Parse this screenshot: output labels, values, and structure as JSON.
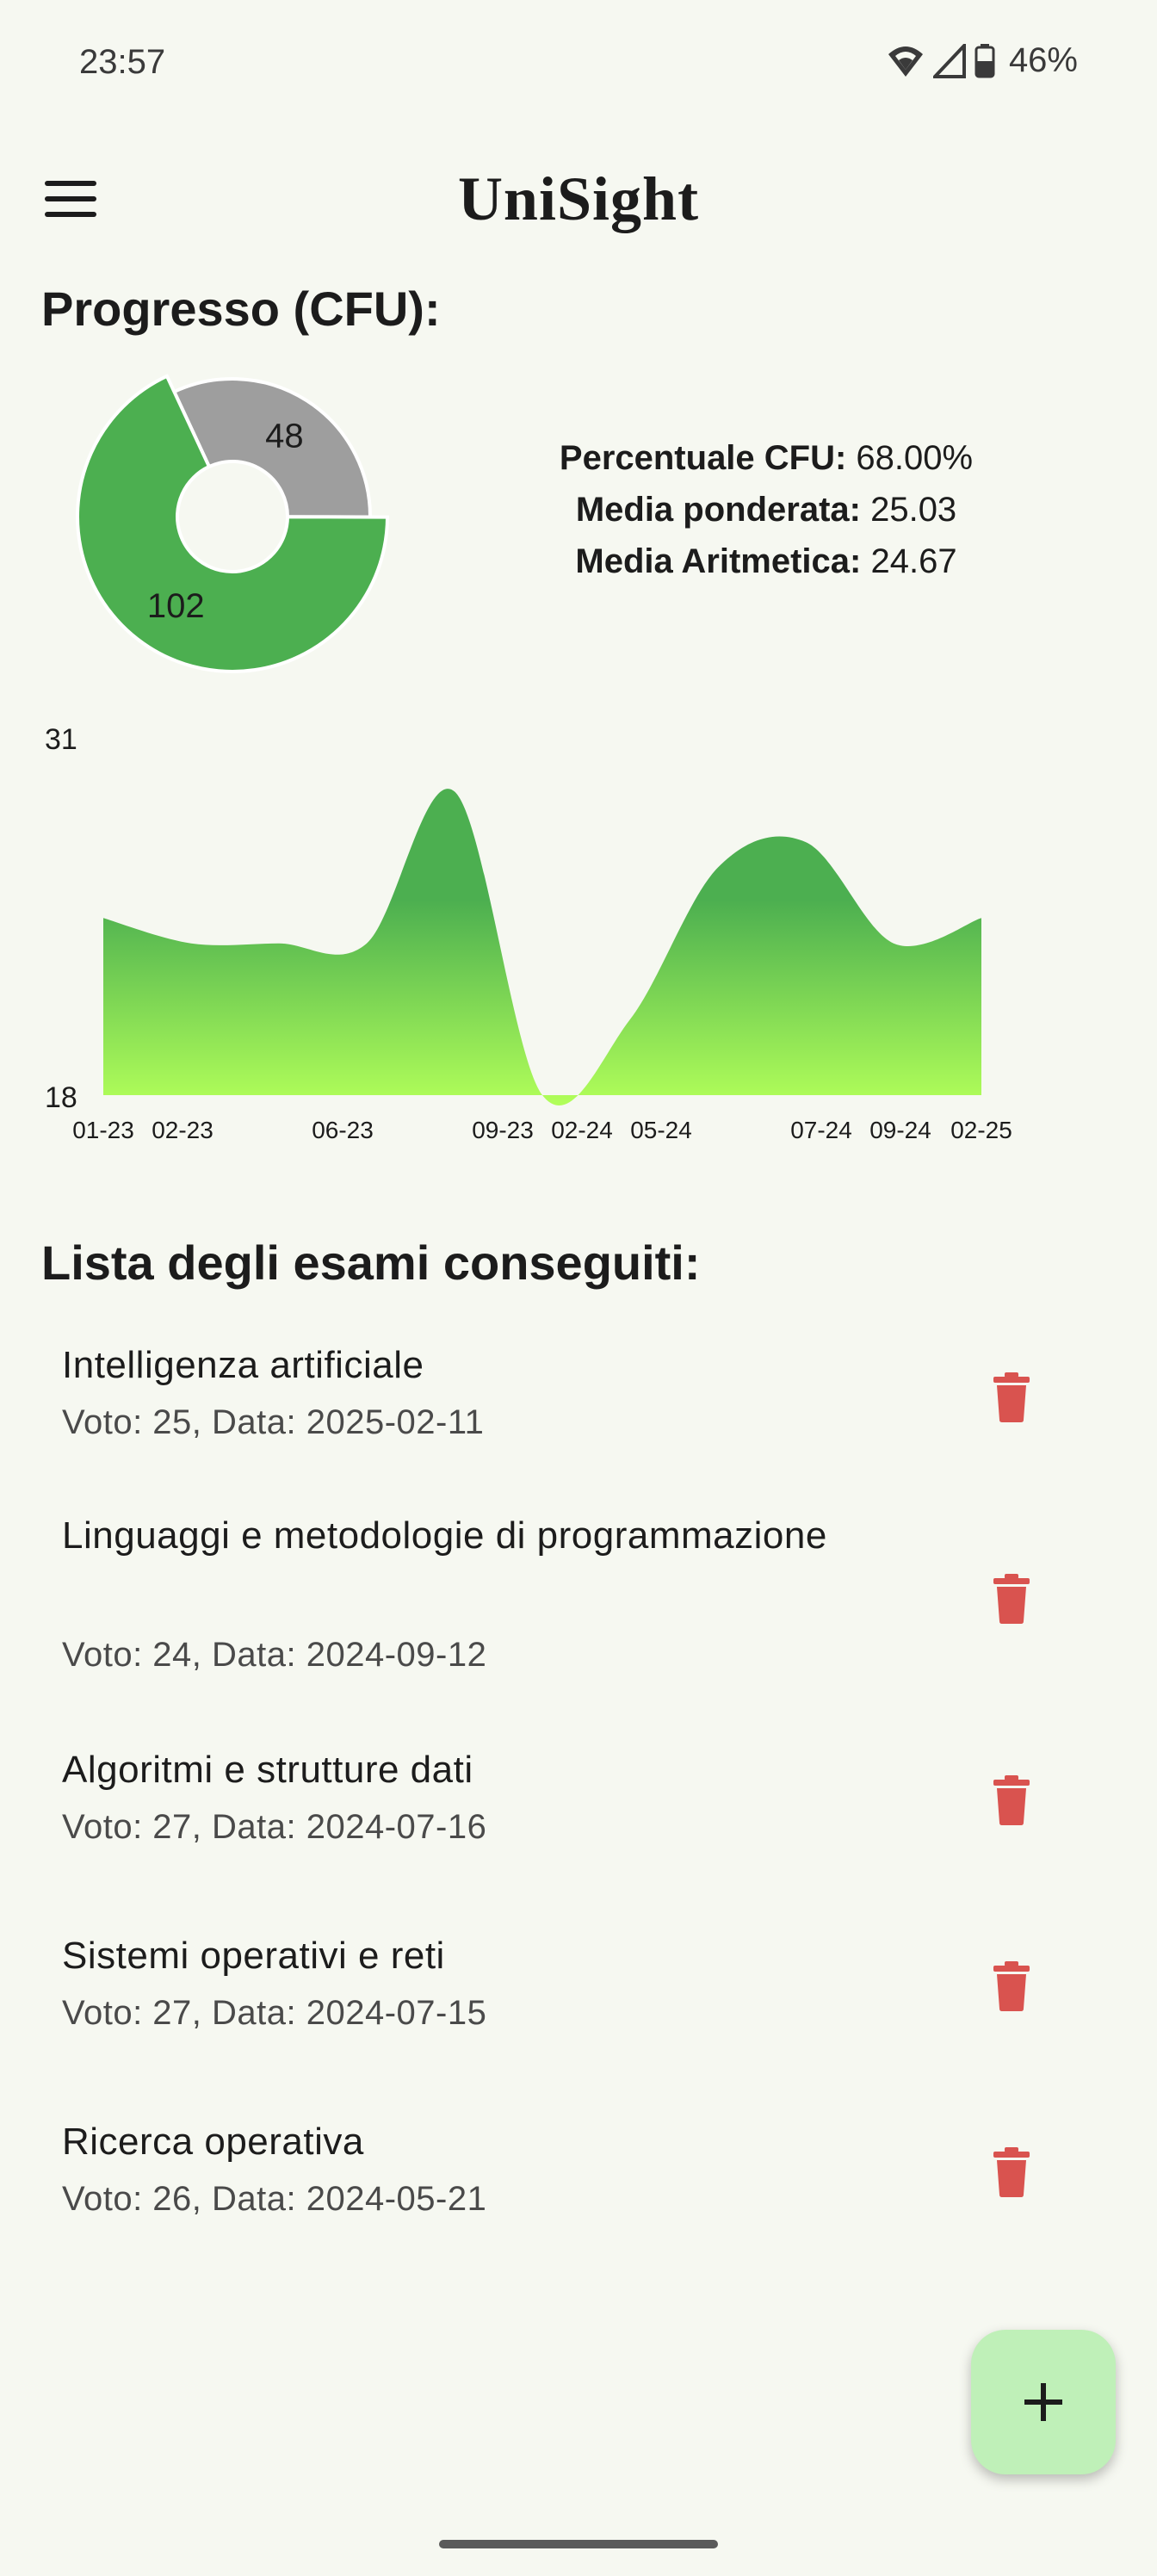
{
  "status": {
    "time": "23:57",
    "battery": "46%"
  },
  "app": {
    "title": "UniSight"
  },
  "progress": {
    "title": "Progresso (CFU):",
    "pie": {
      "acquired": 102,
      "remaining": 48,
      "acquired_label": "102",
      "remaining_label": "48",
      "colors": {
        "acquired": "#4caf50",
        "remaining": "#9e9e9e"
      }
    },
    "stats": [
      {
        "label": "Percentuale CFU:",
        "value": " 68.00%"
      },
      {
        "label": "Media ponderata:",
        "value": " 25.03"
      },
      {
        "label": "Media Aritmetica:",
        "value": " 24.67"
      }
    ]
  },
  "chart_data": {
    "type": "area",
    "title": "",
    "xlabel": "",
    "ylabel": "",
    "ylim": [
      18,
      31
    ],
    "y_tick_labels": [
      "31",
      "18"
    ],
    "x_tick_labels": [
      "01-23",
      "02-23",
      "06-23",
      "09-23",
      "02-24",
      "05-24",
      "07-24",
      "09-24",
      "02-25"
    ],
    "series": [
      {
        "values": [
          25,
          24,
          24,
          24,
          30,
          18,
          21,
          27,
          28,
          24,
          25
        ]
      }
    ],
    "gradient": {
      "top": "#4caf50",
      "bottom": "#b2ff59"
    },
    "grid": false,
    "legend": "none"
  },
  "exams": {
    "title": "Lista degli esami conseguiti:",
    "items": [
      {
        "name": "Intelligenza artificiale",
        "sub": "Voto: 25, Data: 2025-02-11"
      },
      {
        "name": "Linguaggi e metodologie di programmazione",
        "sub": "Voto: 24, Data: 2024-09-12"
      },
      {
        "name": "Algoritmi e strutture dati",
        "sub": "Voto: 27, Data: 2024-07-16"
      },
      {
        "name": "Sistemi operativi e reti",
        "sub": "Voto: 27, Data: 2024-07-15"
      },
      {
        "name": "Ricerca operativa",
        "sub": "Voto: 26, Data: 2024-05-21"
      }
    ],
    "delete_icon": "trash-icon",
    "delete_color": "#d9534f"
  },
  "fab": {
    "icon": "plus-icon"
  }
}
